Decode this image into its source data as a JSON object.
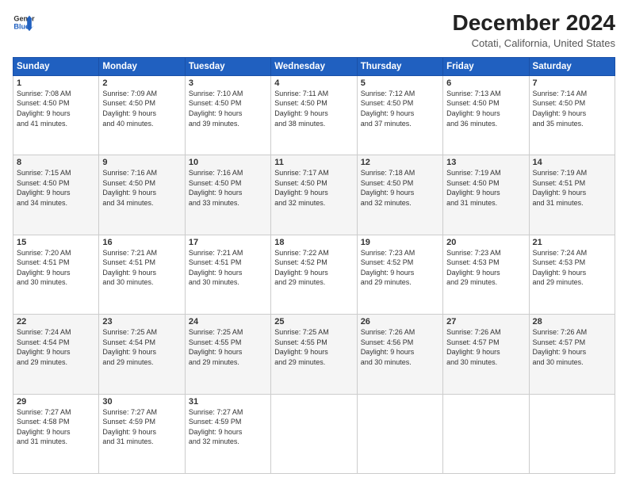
{
  "logo": {
    "line1": "General",
    "line2": "Blue"
  },
  "title": "December 2024",
  "subtitle": "Cotati, California, United States",
  "days_header": [
    "Sunday",
    "Monday",
    "Tuesday",
    "Wednesday",
    "Thursday",
    "Friday",
    "Saturday"
  ],
  "weeks": [
    [
      {
        "day": "1",
        "info": "Sunrise: 7:08 AM\nSunset: 4:50 PM\nDaylight: 9 hours\nand 41 minutes."
      },
      {
        "day": "2",
        "info": "Sunrise: 7:09 AM\nSunset: 4:50 PM\nDaylight: 9 hours\nand 40 minutes."
      },
      {
        "day": "3",
        "info": "Sunrise: 7:10 AM\nSunset: 4:50 PM\nDaylight: 9 hours\nand 39 minutes."
      },
      {
        "day": "4",
        "info": "Sunrise: 7:11 AM\nSunset: 4:50 PM\nDaylight: 9 hours\nand 38 minutes."
      },
      {
        "day": "5",
        "info": "Sunrise: 7:12 AM\nSunset: 4:50 PM\nDaylight: 9 hours\nand 37 minutes."
      },
      {
        "day": "6",
        "info": "Sunrise: 7:13 AM\nSunset: 4:50 PM\nDaylight: 9 hours\nand 36 minutes."
      },
      {
        "day": "7",
        "info": "Sunrise: 7:14 AM\nSunset: 4:50 PM\nDaylight: 9 hours\nand 35 minutes."
      }
    ],
    [
      {
        "day": "8",
        "info": "Sunrise: 7:15 AM\nSunset: 4:50 PM\nDaylight: 9 hours\nand 34 minutes."
      },
      {
        "day": "9",
        "info": "Sunrise: 7:16 AM\nSunset: 4:50 PM\nDaylight: 9 hours\nand 34 minutes."
      },
      {
        "day": "10",
        "info": "Sunrise: 7:16 AM\nSunset: 4:50 PM\nDaylight: 9 hours\nand 33 minutes."
      },
      {
        "day": "11",
        "info": "Sunrise: 7:17 AM\nSunset: 4:50 PM\nDaylight: 9 hours\nand 32 minutes."
      },
      {
        "day": "12",
        "info": "Sunrise: 7:18 AM\nSunset: 4:50 PM\nDaylight: 9 hours\nand 32 minutes."
      },
      {
        "day": "13",
        "info": "Sunrise: 7:19 AM\nSunset: 4:50 PM\nDaylight: 9 hours\nand 31 minutes."
      },
      {
        "day": "14",
        "info": "Sunrise: 7:19 AM\nSunset: 4:51 PM\nDaylight: 9 hours\nand 31 minutes."
      }
    ],
    [
      {
        "day": "15",
        "info": "Sunrise: 7:20 AM\nSunset: 4:51 PM\nDaylight: 9 hours\nand 30 minutes."
      },
      {
        "day": "16",
        "info": "Sunrise: 7:21 AM\nSunset: 4:51 PM\nDaylight: 9 hours\nand 30 minutes."
      },
      {
        "day": "17",
        "info": "Sunrise: 7:21 AM\nSunset: 4:51 PM\nDaylight: 9 hours\nand 30 minutes."
      },
      {
        "day": "18",
        "info": "Sunrise: 7:22 AM\nSunset: 4:52 PM\nDaylight: 9 hours\nand 29 minutes."
      },
      {
        "day": "19",
        "info": "Sunrise: 7:23 AM\nSunset: 4:52 PM\nDaylight: 9 hours\nand 29 minutes."
      },
      {
        "day": "20",
        "info": "Sunrise: 7:23 AM\nSunset: 4:53 PM\nDaylight: 9 hours\nand 29 minutes."
      },
      {
        "day": "21",
        "info": "Sunrise: 7:24 AM\nSunset: 4:53 PM\nDaylight: 9 hours\nand 29 minutes."
      }
    ],
    [
      {
        "day": "22",
        "info": "Sunrise: 7:24 AM\nSunset: 4:54 PM\nDaylight: 9 hours\nand 29 minutes."
      },
      {
        "day": "23",
        "info": "Sunrise: 7:25 AM\nSunset: 4:54 PM\nDaylight: 9 hours\nand 29 minutes."
      },
      {
        "day": "24",
        "info": "Sunrise: 7:25 AM\nSunset: 4:55 PM\nDaylight: 9 hours\nand 29 minutes."
      },
      {
        "day": "25",
        "info": "Sunrise: 7:25 AM\nSunset: 4:55 PM\nDaylight: 9 hours\nand 29 minutes."
      },
      {
        "day": "26",
        "info": "Sunrise: 7:26 AM\nSunset: 4:56 PM\nDaylight: 9 hours\nand 30 minutes."
      },
      {
        "day": "27",
        "info": "Sunrise: 7:26 AM\nSunset: 4:57 PM\nDaylight: 9 hours\nand 30 minutes."
      },
      {
        "day": "28",
        "info": "Sunrise: 7:26 AM\nSunset: 4:57 PM\nDaylight: 9 hours\nand 30 minutes."
      }
    ],
    [
      {
        "day": "29",
        "info": "Sunrise: 7:27 AM\nSunset: 4:58 PM\nDaylight: 9 hours\nand 31 minutes."
      },
      {
        "day": "30",
        "info": "Sunrise: 7:27 AM\nSunset: 4:59 PM\nDaylight: 9 hours\nand 31 minutes."
      },
      {
        "day": "31",
        "info": "Sunrise: 7:27 AM\nSunset: 4:59 PM\nDaylight: 9 hours\nand 32 minutes."
      },
      {
        "day": "",
        "info": ""
      },
      {
        "day": "",
        "info": ""
      },
      {
        "day": "",
        "info": ""
      },
      {
        "day": "",
        "info": ""
      }
    ]
  ]
}
